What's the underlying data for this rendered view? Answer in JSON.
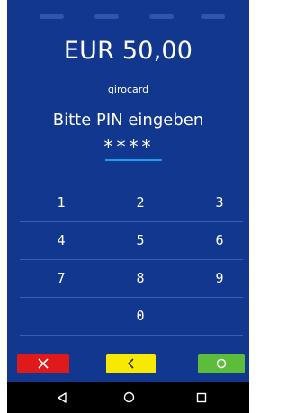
{
  "payment": {
    "amount": "EUR 50,00",
    "card_type": "girocard",
    "prompt": "Bitte PIN eingeben",
    "pin_mask": "****"
  },
  "keypad": {
    "rows": [
      [
        "1",
        "2",
        "3"
      ],
      [
        "4",
        "5",
        "6"
      ],
      [
        "7",
        "8",
        "9"
      ],
      [
        "0"
      ]
    ]
  },
  "actions": {
    "cancel_icon": "close-icon",
    "correction_icon": "chevron-left-icon",
    "confirm_icon": "circle-icon",
    "colors": {
      "cancel": "#e01a1a",
      "correction": "#f5ea00",
      "confirm": "#5cbd3a"
    }
  },
  "navbar": {
    "back_icon": "triangle-back-icon",
    "home_icon": "circle-home-icon",
    "recents_icon": "square-recents-icon"
  },
  "colors": {
    "background": "#12378f",
    "accent": "#1aa0ea"
  }
}
